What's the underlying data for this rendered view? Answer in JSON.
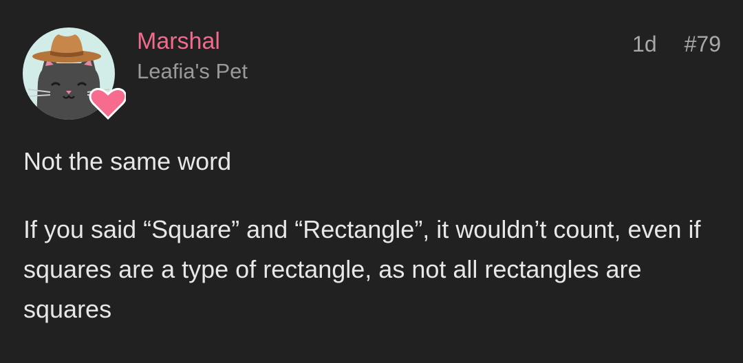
{
  "post": {
    "author": {
      "name": "Marshal",
      "title": "Leafia's Pet",
      "avatar_icon": "cowboy-cat-avatar",
      "badge_icon": "heart-icon",
      "name_color": "#f06b8c",
      "badge_color": "#f76b8f"
    },
    "age": "1d",
    "number": "#79",
    "paragraphs": [
      "Not the same word",
      "If you said “Square” and “Rectangle”, it wouldn’t count, even if squares are a type of rectangle, as not all rectangles are squares"
    ]
  }
}
